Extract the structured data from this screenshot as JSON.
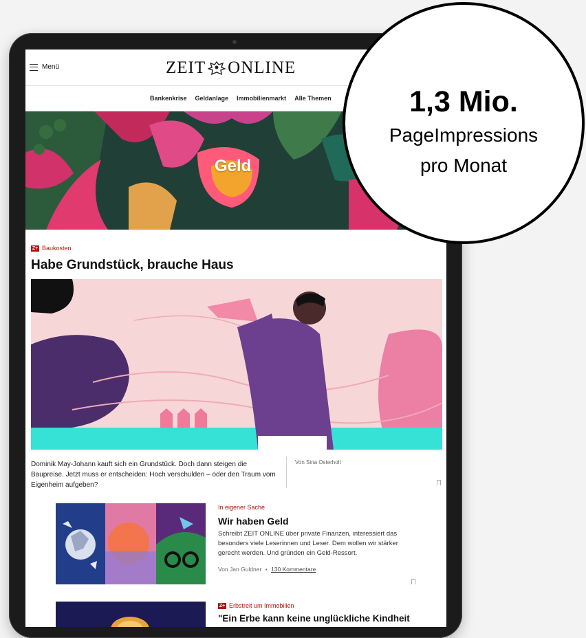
{
  "header": {
    "menu_label": "Menü",
    "logo_left": "ZEIT",
    "logo_right": "ONLINE"
  },
  "nav": {
    "items": [
      "Bankenkrise",
      "Geldanlage",
      "Immobilienmarkt",
      "Alle Themen"
    ]
  },
  "banner": {
    "title": "Geld"
  },
  "article1": {
    "kicker": "Baukosten",
    "headline": "Habe Grundstück, brauche Haus",
    "teaser": "Dominik May-Johann kauft sich ein Grundstück. Doch dann steigen die Baupreise. Jetzt muss er entscheiden: Hoch verschulden – oder den Traum vom Eigenheim aufgeben?",
    "author": "Von Sina Osterholt"
  },
  "article2": {
    "kicker": "In eigener Sache",
    "headline": "Wir haben Geld",
    "teaser": "Schreibt ZEIT ONLINE über private Finanzen, interessiert das besonders viele Leserinnen und Leser. Dem wollen wir stärker gerecht werden. Und gründen ein Geld-Ressort.",
    "author": "Von Jan Guldner",
    "separator": "•",
    "comments": "130 Kommentare"
  },
  "article3": {
    "kicker": "Erbstreit um Immobilien",
    "headline": "\"Ein Erbe kann keine unglückliche Kindheit"
  },
  "badge_letter": "Z+",
  "stat": {
    "value": "1,3 Mio.",
    "line1": "PageImpressions",
    "line2": "pro Monat"
  },
  "colors": {
    "accent_red": "#b4120c",
    "page_bg": "#f3f3f3",
    "tablet_frame": "#1b1b1b"
  }
}
